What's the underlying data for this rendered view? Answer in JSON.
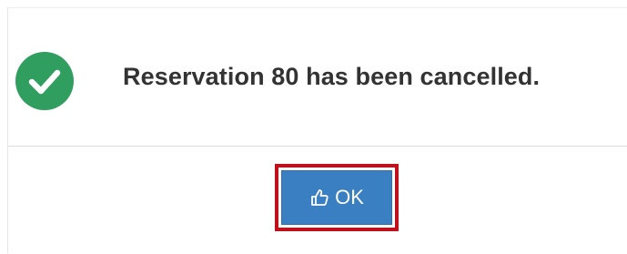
{
  "dialog": {
    "message": "Reservation 80 has been cancelled.",
    "status_icon": "check-circle-icon",
    "ok_button": {
      "label": "OK",
      "icon": "thumbs-up-icon"
    }
  },
  "colors": {
    "success": "#2f9e5f",
    "primary": "#3a7fc1",
    "focus_outline": "#c0101b",
    "text": "#333333"
  }
}
